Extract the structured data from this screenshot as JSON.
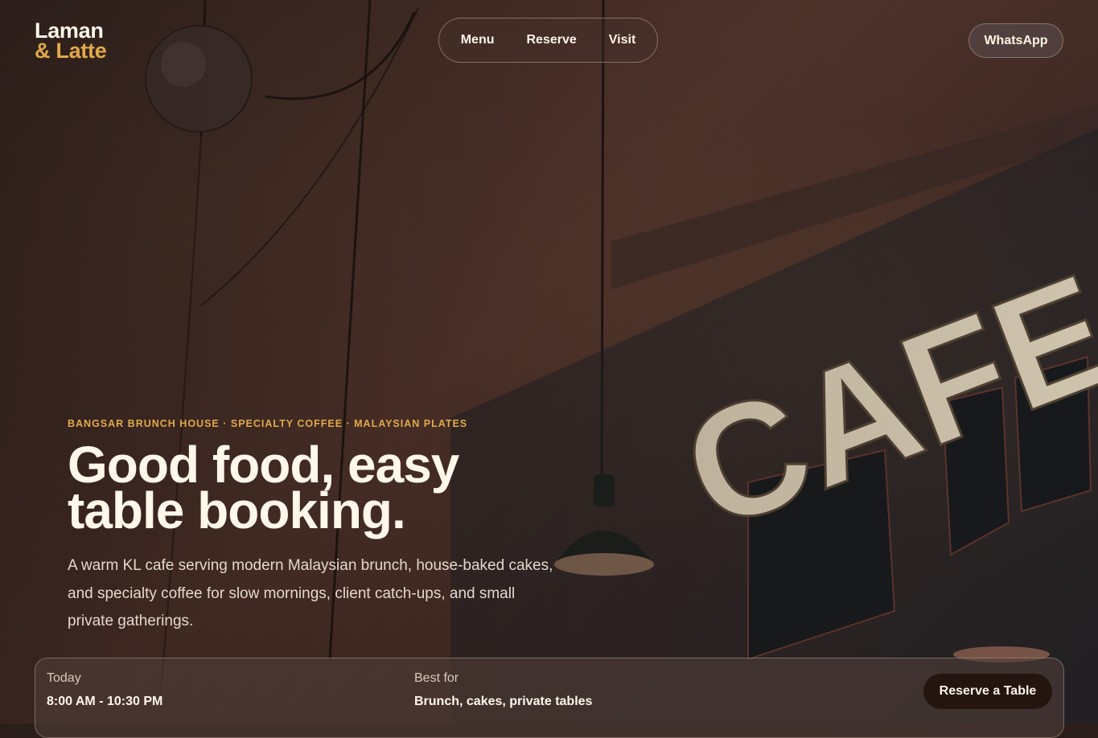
{
  "brand": {
    "line1": "Laman",
    "line2": "& Latte"
  },
  "nav": {
    "items": [
      "Menu",
      "Reserve",
      "Visit"
    ]
  },
  "header": {
    "whatsapp_label": "WhatsApp"
  },
  "hero": {
    "eyebrow": "BANGSAR BRUNCH HOUSE · SPECIALTY COFFEE · MALAYSIAN PLATES",
    "headline_line1": "Good food, easy",
    "headline_line2": "table booking.",
    "description": "A warm KL cafe serving modern Malaysian brunch, house-baked cakes, and specialty coffee for slow mornings, client catch-ups, and small private gatherings.",
    "sign_text": "CAFE"
  },
  "info_bar": {
    "today_label": "Today",
    "today_value": "8:00 AM - 10:30 PM",
    "best_for_label": "Best for",
    "best_for_value": "Brunch, cakes, private tables",
    "cta_label": "Reserve a Table"
  }
}
